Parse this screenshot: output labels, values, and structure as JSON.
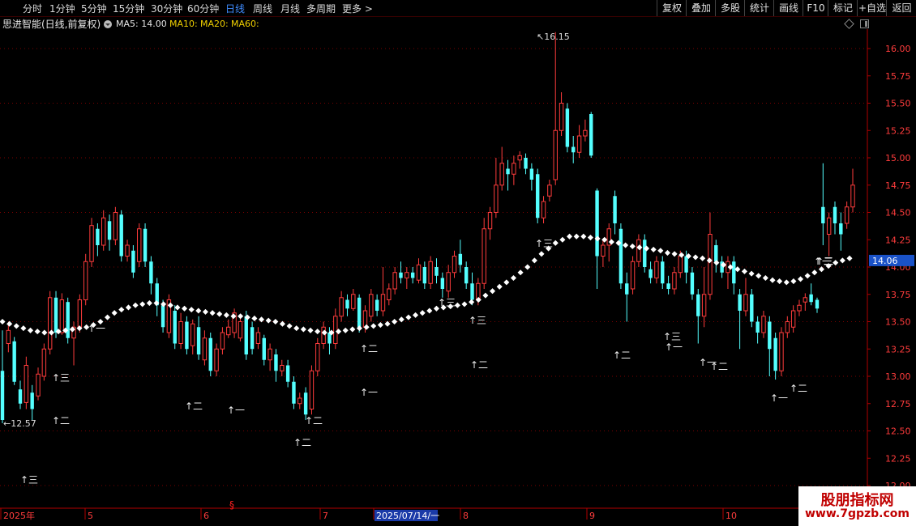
{
  "toolbar": {
    "left_tabs": [
      {
        "label": "分时"
      },
      {
        "label": "1分钟"
      },
      {
        "label": "5分钟"
      },
      {
        "label": "15分钟"
      },
      {
        "label": "30分钟"
      },
      {
        "label": "60分钟"
      },
      {
        "label": "日线"
      },
      {
        "label": "周线"
      },
      {
        "label": "月线"
      },
      {
        "label": "多周期"
      },
      {
        "label": "更多 >"
      }
    ],
    "active_tab": "日线",
    "right_buttons": [
      {
        "label": "复权"
      },
      {
        "label": "叠加"
      },
      {
        "label": "多股"
      },
      {
        "label": "统计"
      },
      {
        "label": "画线"
      },
      {
        "label": "F10"
      },
      {
        "label": "标记"
      },
      {
        "label": "+自选"
      },
      {
        "label": "返回"
      }
    ]
  },
  "info": {
    "stock_name": "思进智能(日线,前复权)",
    "ma5": "MA5: 14.00",
    "ma10": "MA10:",
    "ma20": "MA20:",
    "ma60": "MA60:"
  },
  "colors": {
    "up": "#ff3c3c",
    "down": "#54ffff",
    "grid": "#7a0000",
    "axis_text": "#ff3c3c",
    "ma_line": "#ffffff",
    "current_price_bg": "#1a52c8"
  },
  "chart_data": {
    "type": "candlestick",
    "y_axis_ticks": [
      "16.00",
      "15.75",
      "15.50",
      "15.25",
      "15.00",
      "14.75",
      "14.50",
      "14.25",
      "14.00",
      "13.75",
      "13.50",
      "13.25",
      "13.00",
      "12.75",
      "12.50",
      "12.25",
      "12.00"
    ],
    "ylim": [
      12.0,
      16.25
    ],
    "x_axis_labels": [
      "2025年",
      "5",
      "6",
      "7",
      "2025/07/14/一",
      "8",
      "9",
      "10"
    ],
    "current_price": "14.06",
    "high_label": "16.15",
    "low_label": "12.57",
    "annotations": [
      "↑三",
      "↑二",
      "↑一",
      "↑三",
      "↑二",
      "↑一",
      "↑二",
      "↑二",
      "↑一",
      "↑二",
      "↑三",
      "↑二",
      "↑三",
      "↑三",
      "↑二",
      "↑三",
      "↑一",
      "↑一",
      "↑二",
      "↑一",
      "↑二",
      "↑一",
      "↑二",
      "↑三"
    ],
    "candles": [
      {
        "o": 13.05,
        "c": 12.6,
        "h": 13.42,
        "l": 12.57
      },
      {
        "o": 13.3,
        "c": 13.42,
        "h": 13.48,
        "l": 13.22
      },
      {
        "o": 13.32,
        "c": 12.95,
        "h": 13.36,
        "l": 12.92
      },
      {
        "o": 12.88,
        "c": 12.75,
        "h": 12.96,
        "l": 12.7
      },
      {
        "o": 12.76,
        "c": 13.1,
        "h": 13.18,
        "l": 12.7
      },
      {
        "o": 12.85,
        "c": 12.7,
        "h": 12.92,
        "l": 12.6
      },
      {
        "o": 12.82,
        "c": 13.02,
        "h": 13.08,
        "l": 12.78
      },
      {
        "o": 13.0,
        "c": 13.25,
        "h": 13.3,
        "l": 12.96
      },
      {
        "o": 13.25,
        "c": 13.72,
        "h": 13.78,
        "l": 13.2
      },
      {
        "o": 13.72,
        "c": 13.4,
        "h": 13.78,
        "l": 13.35
      },
      {
        "o": 13.4,
        "c": 13.7,
        "h": 13.76,
        "l": 13.38
      },
      {
        "o": 13.68,
        "c": 13.35,
        "h": 13.72,
        "l": 13.3
      },
      {
        "o": 13.35,
        "c": 13.45,
        "h": 13.5,
        "l": 13.1
      },
      {
        "o": 13.45,
        "c": 13.7,
        "h": 13.75,
        "l": 13.4
      },
      {
        "o": 13.7,
        "c": 14.05,
        "h": 14.12,
        "l": 13.65
      },
      {
        "o": 14.05,
        "c": 14.38,
        "h": 14.45,
        "l": 14.0
      },
      {
        "o": 14.35,
        "c": 14.2,
        "h": 14.4,
        "l": 14.1
      },
      {
        "o": 14.2,
        "c": 14.45,
        "h": 14.52,
        "l": 14.15
      },
      {
        "o": 14.42,
        "c": 14.25,
        "h": 14.48,
        "l": 14.15
      },
      {
        "o": 14.25,
        "c": 14.5,
        "h": 14.55,
        "l": 14.2
      },
      {
        "o": 14.48,
        "c": 14.1,
        "h": 14.52,
        "l": 14.05
      },
      {
        "o": 14.1,
        "c": 14.2,
        "h": 14.25,
        "l": 14.05
      },
      {
        "o": 14.15,
        "c": 13.95,
        "h": 14.2,
        "l": 13.9
      },
      {
        "o": 14.05,
        "c": 14.35,
        "h": 14.4,
        "l": 14.0
      },
      {
        "o": 14.35,
        "c": 14.05,
        "h": 14.4,
        "l": 14.0
      },
      {
        "o": 14.05,
        "c": 13.85,
        "h": 14.1,
        "l": 13.75
      },
      {
        "o": 13.85,
        "c": 13.65,
        "h": 13.9,
        "l": 13.55
      },
      {
        "o": 13.65,
        "c": 13.45,
        "h": 13.7,
        "l": 13.4
      },
      {
        "o": 13.4,
        "c": 13.7,
        "h": 13.75,
        "l": 13.35
      },
      {
        "o": 13.6,
        "c": 13.3,
        "h": 13.65,
        "l": 13.25
      },
      {
        "o": 13.3,
        "c": 13.5,
        "h": 13.58,
        "l": 13.25
      },
      {
        "o": 13.5,
        "c": 13.25,
        "h": 13.55,
        "l": 13.2
      },
      {
        "o": 13.28,
        "c": 13.48,
        "h": 13.52,
        "l": 13.2
      },
      {
        "o": 13.45,
        "c": 13.2,
        "h": 13.55,
        "l": 13.15
      },
      {
        "o": 13.15,
        "c": 13.35,
        "h": 13.42,
        "l": 13.1
      },
      {
        "o": 13.35,
        "c": 13.05,
        "h": 13.4,
        "l": 13.0
      },
      {
        "o": 13.05,
        "c": 13.25,
        "h": 13.3,
        "l": 13.0
      },
      {
        "o": 13.25,
        "c": 13.4,
        "h": 13.45,
        "l": 13.2
      },
      {
        "o": 13.38,
        "c": 13.45,
        "h": 13.52,
        "l": 13.35
      },
      {
        "o": 13.4,
        "c": 13.58,
        "h": 13.62,
        "l": 13.35
      },
      {
        "o": 13.35,
        "c": 13.5,
        "h": 13.55,
        "l": 13.32
      },
      {
        "o": 13.55,
        "c": 13.2,
        "h": 13.6,
        "l": 13.15
      },
      {
        "o": 13.45,
        "c": 13.25,
        "h": 13.5,
        "l": 13.2
      },
      {
        "o": 13.3,
        "c": 13.4,
        "h": 13.45,
        "l": 13.25
      },
      {
        "o": 13.35,
        "c": 13.15,
        "h": 13.38,
        "l": 13.1
      },
      {
        "o": 13.15,
        "c": 13.25,
        "h": 13.3,
        "l": 13.05
      },
      {
        "o": 13.2,
        "c": 13.05,
        "h": 13.25,
        "l": 12.95
      },
      {
        "o": 13.05,
        "c": 13.1,
        "h": 13.15,
        "l": 13.0
      },
      {
        "o": 13.1,
        "c": 12.95,
        "h": 13.15,
        "l": 12.9
      },
      {
        "o": 12.95,
        "c": 12.75,
        "h": 13.0,
        "l": 12.7
      },
      {
        "o": 12.75,
        "c": 12.8,
        "h": 12.85,
        "l": 12.7
      },
      {
        "o": 12.85,
        "c": 12.65,
        "h": 12.9,
        "l": 12.6
      },
      {
        "o": 12.7,
        "c": 13.05,
        "h": 13.1,
        "l": 12.65
      },
      {
        "o": 13.05,
        "c": 13.3,
        "h": 13.35,
        "l": 13.0
      },
      {
        "o": 13.3,
        "c": 13.45,
        "h": 13.5,
        "l": 13.25
      },
      {
        "o": 13.4,
        "c": 13.3,
        "h": 13.45,
        "l": 13.2
      },
      {
        "o": 13.3,
        "c": 13.55,
        "h": 13.62,
        "l": 13.25
      },
      {
        "o": 13.55,
        "c": 13.72,
        "h": 13.78,
        "l": 13.5
      },
      {
        "o": 13.7,
        "c": 13.62,
        "h": 13.75,
        "l": 13.55
      },
      {
        "o": 13.62,
        "c": 13.75,
        "h": 13.8,
        "l": 13.6
      },
      {
        "o": 13.72,
        "c": 13.45,
        "h": 13.75,
        "l": 13.4
      },
      {
        "o": 13.45,
        "c": 13.6,
        "h": 13.65,
        "l": 13.4
      },
      {
        "o": 13.55,
        "c": 13.75,
        "h": 13.8,
        "l": 13.5
      },
      {
        "o": 13.7,
        "c": 13.6,
        "h": 13.75,
        "l": 13.55
      },
      {
        "o": 13.6,
        "c": 13.75,
        "h": 14.0,
        "l": 13.55
      },
      {
        "o": 13.7,
        "c": 13.8,
        "h": 13.85,
        "l": 13.65
      },
      {
        "o": 13.8,
        "c": 13.95,
        "h": 14.0,
        "l": 13.75
      },
      {
        "o": 13.95,
        "c": 13.9,
        "h": 14.05,
        "l": 13.85
      },
      {
        "o": 13.9,
        "c": 13.95,
        "h": 14.0,
        "l": 13.8
      },
      {
        "o": 13.95,
        "c": 13.9,
        "h": 14.0,
        "l": 13.85
      },
      {
        "o": 13.88,
        "c": 14.02,
        "h": 14.08,
        "l": 13.85
      },
      {
        "o": 14.0,
        "c": 13.85,
        "h": 14.05,
        "l": 13.8
      },
      {
        "o": 13.85,
        "c": 14.05,
        "h": 14.1,
        "l": 13.8
      },
      {
        "o": 14.0,
        "c": 13.92,
        "h": 14.08,
        "l": 13.85
      },
      {
        "o": 13.9,
        "c": 13.8,
        "h": 13.95,
        "l": 13.72
      },
      {
        "o": 13.78,
        "c": 13.95,
        "h": 14.02,
        "l": 13.72
      },
      {
        "o": 13.95,
        "c": 14.1,
        "h": 14.15,
        "l": 13.9
      },
      {
        "o": 14.12,
        "c": 14.02,
        "h": 14.25,
        "l": 13.95
      },
      {
        "o": 14.0,
        "c": 13.85,
        "h": 14.05,
        "l": 13.8
      },
      {
        "o": 13.85,
        "c": 13.7,
        "h": 13.95,
        "l": 13.65
      },
      {
        "o": 13.7,
        "c": 13.85,
        "h": 13.9,
        "l": 13.65
      },
      {
        "o": 13.85,
        "c": 14.35,
        "h": 14.45,
        "l": 13.8
      },
      {
        "o": 14.35,
        "c": 14.5,
        "h": 14.55,
        "l": 14.25
      },
      {
        "o": 14.5,
        "c": 14.75,
        "h": 15.0,
        "l": 14.45
      },
      {
        "o": 14.75,
        "c": 14.95,
        "h": 15.1,
        "l": 14.7
      },
      {
        "o": 14.9,
        "c": 14.85,
        "h": 14.98,
        "l": 14.7
      },
      {
        "o": 14.85,
        "c": 14.95,
        "h": 15.02,
        "l": 14.75
      },
      {
        "o": 14.98,
        "c": 15.02,
        "h": 15.06,
        "l": 14.9
      },
      {
        "o": 15.0,
        "c": 14.9,
        "h": 15.04,
        "l": 14.85
      },
      {
        "o": 14.9,
        "c": 14.8,
        "h": 14.95,
        "l": 14.7
      },
      {
        "o": 14.85,
        "c": 14.45,
        "h": 14.9,
        "l": 14.4
      },
      {
        "o": 14.45,
        "c": 14.6,
        "h": 14.65,
        "l": 14.4
      },
      {
        "o": 14.65,
        "c": 14.75,
        "h": 14.8,
        "l": 14.6
      },
      {
        "o": 14.8,
        "c": 15.25,
        "h": 16.15,
        "l": 14.75
      },
      {
        "o": 15.25,
        "c": 15.5,
        "h": 15.6,
        "l": 15.2
      },
      {
        "o": 15.45,
        "c": 15.1,
        "h": 15.5,
        "l": 15.05
      },
      {
        "o": 15.1,
        "c": 15.05,
        "h": 15.2,
        "l": 14.95
      },
      {
        "o": 15.05,
        "c": 15.2,
        "h": 15.3,
        "l": 15.0
      },
      {
        "o": 15.2,
        "c": 15.25,
        "h": 15.35,
        "l": 15.15
      },
      {
        "o": 15.4,
        "c": 15.02,
        "h": 15.42,
        "l": 15.0
      },
      {
        "o": 14.7,
        "c": 14.1,
        "h": 14.72,
        "l": 13.8
      },
      {
        "o": 14.1,
        "c": 14.2,
        "h": 14.25,
        "l": 14.0
      },
      {
        "o": 14.2,
        "c": 14.35,
        "h": 14.4,
        "l": 14.05
      },
      {
        "o": 14.65,
        "c": 14.4,
        "h": 14.7,
        "l": 14.3
      },
      {
        "o": 14.35,
        "c": 13.85,
        "h": 14.4,
        "l": 13.8
      },
      {
        "o": 13.85,
        "c": 13.75,
        "h": 13.95,
        "l": 13.5
      },
      {
        "o": 13.8,
        "c": 14.05,
        "h": 14.1,
        "l": 13.75
      },
      {
        "o": 14.05,
        "c": 14.25,
        "h": 14.3,
        "l": 14.0
      },
      {
        "o": 14.25,
        "c": 14.0,
        "h": 14.3,
        "l": 13.95
      },
      {
        "o": 13.98,
        "c": 13.9,
        "h": 14.05,
        "l": 13.85
      },
      {
        "o": 13.9,
        "c": 14.05,
        "h": 14.1,
        "l": 13.85
      },
      {
        "o": 14.05,
        "c": 13.85,
        "h": 14.1,
        "l": 13.8
      },
      {
        "o": 13.85,
        "c": 13.8,
        "h": 13.92,
        "l": 13.75
      },
      {
        "o": 13.8,
        "c": 13.95,
        "h": 14.0,
        "l": 13.75
      },
      {
        "o": 13.95,
        "c": 14.1,
        "h": 14.15,
        "l": 13.9
      },
      {
        "o": 14.1,
        "c": 13.95,
        "h": 14.15,
        "l": 13.85
      },
      {
        "o": 13.95,
        "c": 13.75,
        "h": 14.0,
        "l": 13.7
      },
      {
        "o": 13.75,
        "c": 13.55,
        "h": 13.8,
        "l": 13.3
      },
      {
        "o": 13.55,
        "c": 13.75,
        "h": 14.0,
        "l": 13.45
      },
      {
        "o": 13.75,
        "c": 14.3,
        "h": 14.5,
        "l": 13.7
      },
      {
        "o": 14.2,
        "c": 14.05,
        "h": 14.25,
        "l": 13.95
      },
      {
        "o": 14.05,
        "c": 13.95,
        "h": 14.1,
        "l": 13.9
      },
      {
        "o": 13.95,
        "c": 14.05,
        "h": 14.1,
        "l": 13.8
      },
      {
        "o": 14.05,
        "c": 13.85,
        "h": 14.1,
        "l": 13.75
      },
      {
        "o": 13.75,
        "c": 13.6,
        "h": 13.8,
        "l": 13.25
      },
      {
        "o": 13.6,
        "c": 13.75,
        "h": 13.9,
        "l": 13.55
      },
      {
        "o": 13.75,
        "c": 13.5,
        "h": 13.8,
        "l": 13.45
      },
      {
        "o": 13.5,
        "c": 13.4,
        "h": 13.55,
        "l": 13.3
      },
      {
        "o": 13.4,
        "c": 13.55,
        "h": 13.6,
        "l": 13.35
      },
      {
        "o": 13.5,
        "c": 13.25,
        "h": 13.55,
        "l": 13.0
      },
      {
        "o": 13.35,
        "c": 13.05,
        "h": 13.4,
        "l": 12.97
      },
      {
        "o": 13.05,
        "c": 13.4,
        "h": 13.45,
        "l": 13.0
      },
      {
        "o": 13.4,
        "c": 13.5,
        "h": 13.55,
        "l": 13.35
      },
      {
        "o": 13.45,
        "c": 13.6,
        "h": 13.65,
        "l": 13.4
      },
      {
        "o": 13.6,
        "c": 13.65,
        "h": 13.7,
        "l": 13.55
      },
      {
        "o": 13.68,
        "c": 13.72,
        "h": 13.76,
        "l": 13.6
      },
      {
        "o": 13.75,
        "c": 13.68,
        "h": 13.85,
        "l": 13.65
      },
      {
        "o": 13.7,
        "c": 13.62,
        "h": 13.72,
        "l": 13.58
      },
      {
        "o": 14.55,
        "c": 14.4,
        "h": 14.95,
        "l": 14.2
      },
      {
        "o": 14.3,
        "c": 14.45,
        "h": 14.5,
        "l": 14.1
      },
      {
        "o": 14.55,
        "c": 14.4,
        "h": 14.6,
        "l": 14.3
      },
      {
        "o": 14.4,
        "c": 14.3,
        "h": 14.5,
        "l": 14.15
      },
      {
        "o": 14.4,
        "c": 14.55,
        "h": 14.6,
        "l": 14.35
      },
      {
        "o": 14.55,
        "c": 14.75,
        "h": 14.9,
        "l": 14.5
      }
    ],
    "ma_line": [
      13.5,
      13.48,
      13.46,
      13.44,
      13.42,
      13.41,
      13.4,
      13.4,
      13.41,
      13.42,
      13.43,
      13.44,
      13.45,
      13.47,
      13.5,
      13.54,
      13.58,
      13.61,
      13.63,
      13.65,
      13.66,
      13.67,
      13.67,
      13.66,
      13.65,
      13.63,
      13.62,
      13.61,
      13.6,
      13.59,
      13.58,
      13.57,
      13.56,
      13.55,
      13.55,
      13.54,
      13.53,
      13.52,
      13.51,
      13.5,
      13.48,
      13.46,
      13.44,
      13.43,
      13.42,
      13.41,
      13.4,
      13.4,
      13.41,
      13.42,
      13.43,
      13.44,
      13.45,
      13.46,
      13.47,
      13.48,
      13.5,
      13.52,
      13.54,
      13.56,
      13.58,
      13.6,
      13.62,
      13.63,
      13.64,
      13.65,
      13.66,
      13.68,
      13.7,
      13.74,
      13.78,
      13.82,
      13.86,
      13.9,
      13.95,
      14.0,
      14.06,
      14.12,
      14.17,
      14.22,
      14.25,
      14.28,
      14.28,
      14.28,
      14.27,
      14.26,
      14.25,
      14.23,
      14.22,
      14.2,
      14.19,
      14.18,
      14.17,
      14.16,
      14.15,
      14.13,
      14.12,
      14.11,
      14.1,
      14.09,
      14.08,
      14.06,
      14.04,
      14.02,
      14.0,
      13.98,
      13.96,
      13.94,
      13.92,
      13.9,
      13.88,
      13.87,
      13.86,
      13.87,
      13.89,
      13.92,
      13.95,
      13.98,
      14.01,
      14.04,
      14.06,
      14.08
    ]
  },
  "watermark": {
    "title": "股朋指标网",
    "url": "www.7gpzb.com"
  }
}
